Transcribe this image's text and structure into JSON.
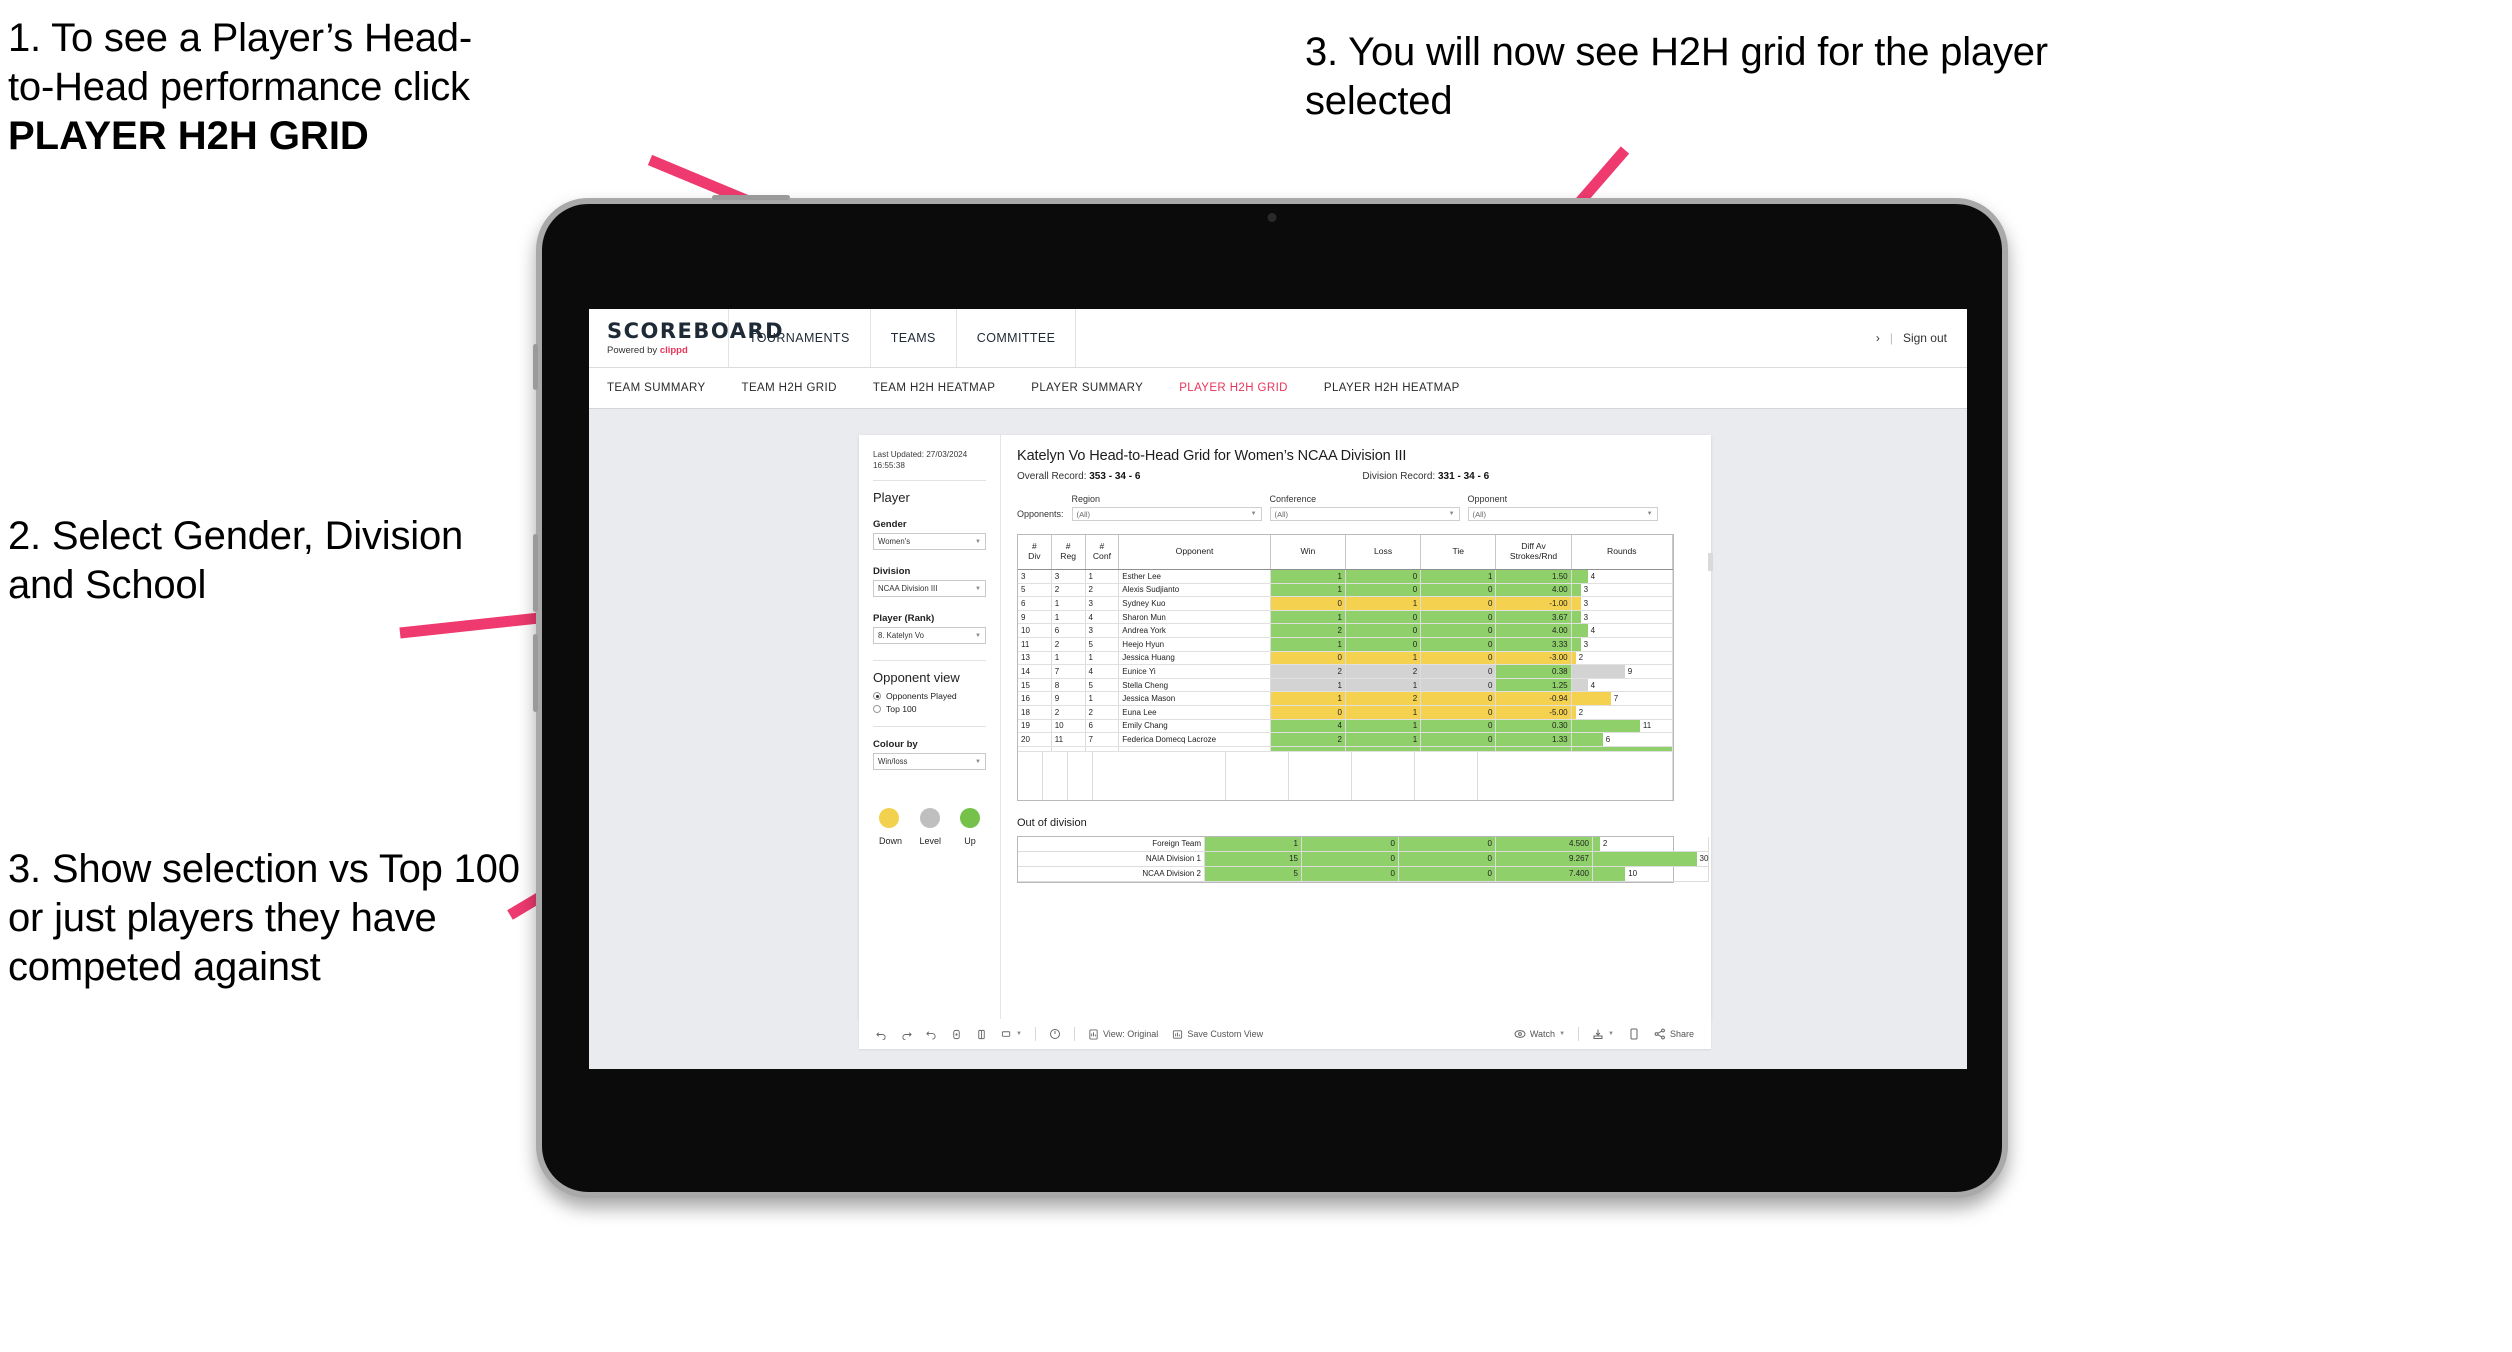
{
  "annotations": [
    {
      "id": "anno-1",
      "line1": "1. To see a Player’s Head-",
      "line2": "to-Head performance click",
      "bold": "PLAYER H2H GRID"
    },
    {
      "id": "anno-2",
      "text": "2. Select Gender, Division and School"
    },
    {
      "id": "anno-3",
      "text": "3. Show selection vs Top 100 or just players they have competed against"
    },
    {
      "id": "anno-4",
      "text": "3. You will now see H2H grid for the player selected"
    }
  ],
  "app": {
    "logo": "SCOREBOARD",
    "logo_sub_prefix": "Powered by ",
    "logo_sub_brand": "clippd",
    "top_nav": [
      "TOURNAMENTS",
      "TEAMS",
      "COMMITTEE"
    ],
    "header_right": {
      "caret": "›",
      "sep": "|",
      "sign_out": "Sign out"
    },
    "sub_nav": [
      {
        "label": "TEAM SUMMARY",
        "active": false
      },
      {
        "label": "TEAM H2H GRID",
        "active": false
      },
      {
        "label": "TEAM H2H HEATMAP",
        "active": false
      },
      {
        "label": "PLAYER SUMMARY",
        "active": false
      },
      {
        "label": "PLAYER H2H GRID",
        "active": true
      },
      {
        "label": "PLAYER H2H HEATMAP",
        "active": false
      }
    ]
  },
  "filters": {
    "last_updated_line1": "Last Updated: 27/03/2024",
    "last_updated_line2": "16:55:38",
    "section_title": "Player",
    "gender": {
      "label": "Gender",
      "value": "Women's"
    },
    "division": {
      "label": "Division",
      "value": "NCAA Division III"
    },
    "player": {
      "label": "Player (Rank)",
      "value": "8. Katelyn Vo"
    },
    "opponent_view": {
      "title": "Opponent view",
      "options": [
        {
          "label": "Opponents Played",
          "selected": true
        },
        {
          "label": "Top 100",
          "selected": false
        }
      ]
    },
    "colour_by": {
      "label": "Colour by",
      "value": "Win/loss"
    },
    "legend": [
      {
        "label": "Down",
        "color": "#f2d14e"
      },
      {
        "label": "Level",
        "color": "#bfbfbf"
      },
      {
        "label": "Up",
        "color": "#76c14a"
      }
    ]
  },
  "viz": {
    "title": "Katelyn Vo Head-to-Head Grid for Women’s NCAA Division III",
    "overall_record_label": "Overall Record: ",
    "overall_record_value": "353 -  34 - 6",
    "division_record_label": "Division Record: ",
    "division_record_value": "331 -  34 - 6",
    "opponents_word": "Opponents:",
    "opponent_filters": [
      {
        "label": "Region",
        "value": "(All)"
      },
      {
        "label": "Conference",
        "value": "(All)"
      },
      {
        "label": "Opponent",
        "value": "(All)"
      }
    ],
    "columns": [
      "# Div",
      "# Reg",
      "# Conf",
      "Opponent",
      "Win",
      "Loss",
      "Tie",
      "Diff Av Strokes/Rnd",
      "Rounds"
    ],
    "columns_split": [
      {
        "l1": "#",
        "l2": "Div"
      },
      {
        "l1": "#",
        "l2": "Reg"
      },
      {
        "l1": "#",
        "l2": "Conf"
      },
      {
        "l1": "Opponent",
        "l2": ""
      },
      {
        "l1": "Win",
        "l2": ""
      },
      {
        "l1": "Loss",
        "l2": ""
      },
      {
        "l1": "Tie",
        "l2": ""
      },
      {
        "l1": "Diff Av",
        "l2": "Strokes/Rnd"
      },
      {
        "l1": "Rounds",
        "l2": ""
      }
    ],
    "rows": [
      {
        "div": "3",
        "reg": "3",
        "conf": "1",
        "opponent": "Esther Lee",
        "win": "1",
        "loss": "0",
        "tie": "1",
        "diff": "1.50",
        "rounds": "4",
        "color": "g",
        "bar_pct": 16
      },
      {
        "div": "5",
        "reg": "2",
        "conf": "2",
        "opponent": "Alexis Sudjianto",
        "win": "1",
        "loss": "0",
        "tie": "0",
        "diff": "4.00",
        "rounds": "3",
        "color": "g",
        "bar_pct": 9
      },
      {
        "div": "6",
        "reg": "1",
        "conf": "3",
        "opponent": "Sydney Kuo",
        "win": "0",
        "loss": "1",
        "tie": "0",
        "diff": "-1.00",
        "rounds": "3",
        "color": "y",
        "bar_pct": 9
      },
      {
        "div": "9",
        "reg": "1",
        "conf": "4",
        "opponent": "Sharon Mun",
        "win": "1",
        "loss": "0",
        "tie": "0",
        "diff": "3.67",
        "rounds": "3",
        "color": "g",
        "bar_pct": 9
      },
      {
        "div": "10",
        "reg": "6",
        "conf": "3",
        "opponent": "Andrea York",
        "win": "2",
        "loss": "0",
        "tie": "0",
        "diff": "4.00",
        "rounds": "4",
        "color": "g",
        "bar_pct": 16
      },
      {
        "div": "11",
        "reg": "2",
        "conf": "5",
        "opponent": "Heejo Hyun",
        "win": "1",
        "loss": "0",
        "tie": "0",
        "diff": "3.33",
        "rounds": "3",
        "color": "g",
        "bar_pct": 9
      },
      {
        "div": "13",
        "reg": "1",
        "conf": "1",
        "opponent": "Jessica Huang",
        "win": "0",
        "loss": "1",
        "tie": "0",
        "diff": "-3.00",
        "rounds": "2",
        "color": "y",
        "bar_pct": 4
      },
      {
        "div": "14",
        "reg": "7",
        "conf": "4",
        "opponent": "Eunice Yi",
        "win": "2",
        "loss": "2",
        "tie": "0",
        "diff": "0.38",
        "rounds": "9",
        "color": "gr",
        "diff_color": "g",
        "bar_pct": 53
      },
      {
        "div": "15",
        "reg": "8",
        "conf": "5",
        "opponent": "Stella Cheng",
        "win": "1",
        "loss": "1",
        "tie": "0",
        "diff": "1.25",
        "rounds": "4",
        "color": "gr",
        "diff_color": "g",
        "bar_pct": 16
      },
      {
        "div": "16",
        "reg": "9",
        "conf": "1",
        "opponent": "Jessica Mason",
        "win": "1",
        "loss": "2",
        "tie": "0",
        "diff": "-0.94",
        "rounds": "7",
        "color": "y",
        "bar_pct": 39
      },
      {
        "div": "18",
        "reg": "2",
        "conf": "2",
        "opponent": "Euna Lee",
        "win": "0",
        "loss": "1",
        "tie": "0",
        "diff": "-5.00",
        "rounds": "2",
        "color": "y",
        "bar_pct": 4
      },
      {
        "div": "19",
        "reg": "10",
        "conf": "6",
        "opponent": "Emily Chang",
        "win": "4",
        "loss": "1",
        "tie": "0",
        "diff": "0.30",
        "rounds": "11",
        "color": "g",
        "bar_pct": 68
      },
      {
        "div": "20",
        "reg": "11",
        "conf": "7",
        "opponent": "Federica Domecq Lacroze",
        "win": "2",
        "loss": "1",
        "tie": "0",
        "diff": "1.33",
        "rounds": "6",
        "color": "g",
        "bar_pct": 31
      }
    ],
    "out_of_division": {
      "title": "Out of division",
      "rows": [
        {
          "name": "Foreign Team",
          "win": "1",
          "loss": "0",
          "tie": "0",
          "diff": "4.500",
          "rounds": "2",
          "color": "g",
          "bar_pct": 6
        },
        {
          "name": "NAIA Division 1",
          "win": "15",
          "loss": "0",
          "tie": "0",
          "diff": "9.267",
          "rounds": "30",
          "color": "g",
          "bar_pct": 90
        },
        {
          "name": "NCAA Division 2",
          "win": "5",
          "loss": "0",
          "tie": "0",
          "diff": "7.400",
          "rounds": "10",
          "color": "g",
          "bar_pct": 28
        }
      ]
    }
  },
  "toolbar": {
    "view_label": "View: Original",
    "save_label": "Save Custom View",
    "watch_label": "Watch",
    "share_label": "Share"
  },
  "colors": {
    "accent": "#e8345a",
    "green": "#8fd06a",
    "yellow": "#f4d250",
    "grey": "#d3d3d3"
  }
}
